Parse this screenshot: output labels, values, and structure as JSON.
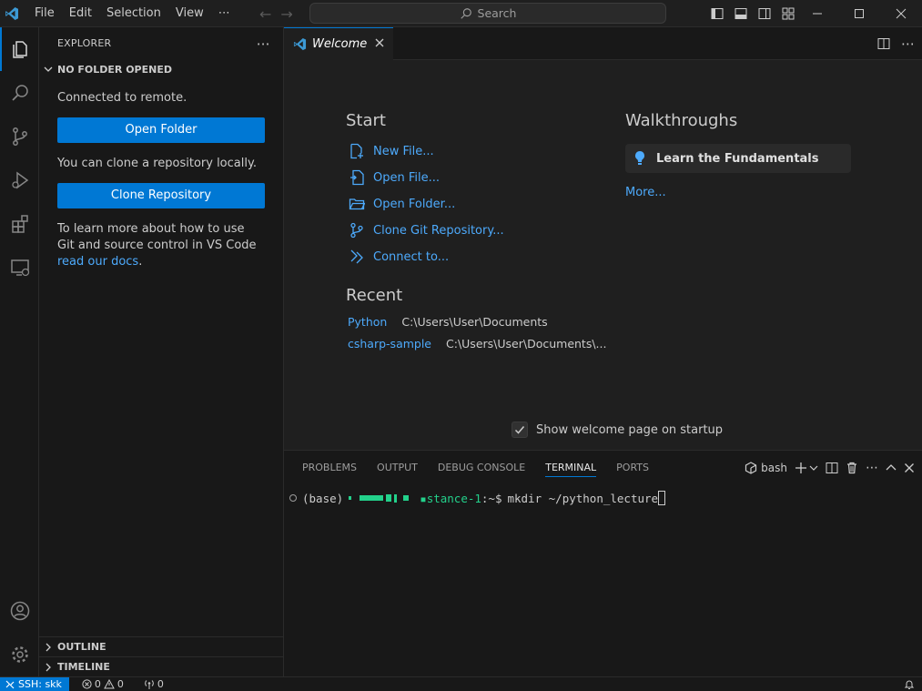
{
  "titlebar": {
    "menu": [
      "File",
      "Edit",
      "Selection",
      "View",
      "⋯"
    ],
    "search_placeholder": "Search"
  },
  "sidebar": {
    "title": "EXPLORER",
    "more": "⋯",
    "section": "NO FOLDER OPENED",
    "connected_text": "Connected to remote.",
    "open_folder_label": "Open Folder",
    "clone_text": "You can clone a repository locally.",
    "clone_button_label": "Clone Repository",
    "git_text": "To learn more about how to use Git and source control in VS Code ",
    "git_link": "read our docs",
    "git_period": ".",
    "outline": "OUTLINE",
    "timeline": "TIMELINE"
  },
  "editor": {
    "tab_label": "Welcome",
    "start_heading": "Start",
    "start_items": [
      {
        "label": "New File...",
        "icon": "new-file-icon"
      },
      {
        "label": "Open File...",
        "icon": "open-file-icon"
      },
      {
        "label": "Open Folder...",
        "icon": "folder-icon"
      },
      {
        "label": "Clone Git Repository...",
        "icon": "git-branch-icon"
      },
      {
        "label": "Connect to...",
        "icon": "remote-icon"
      }
    ],
    "recent_heading": "Recent",
    "recent": [
      {
        "name": "Python",
        "path": "C:\\Users\\User\\Documents"
      },
      {
        "name": "csharp-sample",
        "path": "C:\\Users\\User\\Documents\\..."
      }
    ],
    "walkthroughs_heading": "Walkthroughs",
    "walkthrough_card": "Learn the Fundamentals",
    "more_link": "More...",
    "startup_label": "Show welcome page on startup"
  },
  "panel": {
    "tabs": [
      "PROBLEMS",
      "OUTPUT",
      "DEBUG CONSOLE",
      "TERMINAL",
      "PORTS"
    ],
    "active_tab": "TERMINAL",
    "shell": "bash",
    "prompt_prefix": "(base)",
    "prompt_host": "stance-1",
    "prompt_suffix": ":~$",
    "command": "mkdir ~/python_lecture"
  },
  "statusbar": {
    "remote": "SSH: skk",
    "errors": "0",
    "warnings": "0",
    "ports": "0"
  },
  "colors": {
    "accent": "#0078d4",
    "link": "#4daafc",
    "terminal_green": "#23d18b"
  }
}
